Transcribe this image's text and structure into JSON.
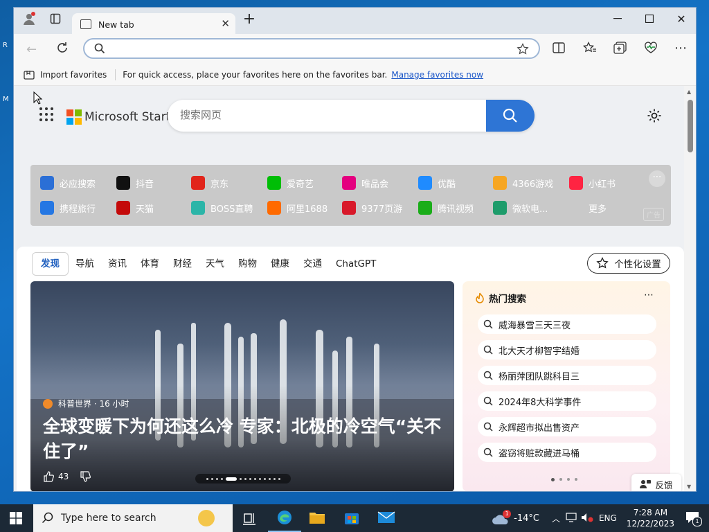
{
  "browser": {
    "tab_title": "New tab",
    "address_value": "",
    "favbar": {
      "import_label": "Import favorites",
      "message": "For quick access, place your favorites here on the favorites bar.",
      "manage_link": "Manage favorites now"
    }
  },
  "start": {
    "brand": "Microsoft Start",
    "search_placeholder": "搜索网页",
    "quick_links": [
      {
        "label": "必应搜索",
        "icon": "bing-search-icon",
        "color": "#2b6fd6"
      },
      {
        "label": "抖音",
        "icon": "douyin-icon",
        "color": "#111111"
      },
      {
        "label": "京东",
        "icon": "jd-icon",
        "color": "#e1251b"
      },
      {
        "label": "爱奇艺",
        "icon": "iqiyi-icon",
        "color": "#00be06"
      },
      {
        "label": "唯品会",
        "icon": "vip-icon",
        "color": "#e4007f"
      },
      {
        "label": "优酷",
        "icon": "youku-icon",
        "color": "#1f8bff"
      },
      {
        "label": "4366游戏",
        "icon": "game-4366-icon",
        "color": "#f6a623"
      },
      {
        "label": "小红书",
        "icon": "xiaohongshu-icon",
        "color": "#ff2442"
      },
      {
        "label": "携程旅行",
        "icon": "ctrip-icon",
        "color": "#2577e3"
      },
      {
        "label": "天猫",
        "icon": "tmall-icon",
        "color": "#c40a0a"
      },
      {
        "label": "BOSS直聘",
        "icon": "boss-icon",
        "color": "#2cb5a8"
      },
      {
        "label": "阿里1688",
        "icon": "ali1688-icon",
        "color": "#ff6a00"
      },
      {
        "label": "9377页游",
        "icon": "game-9377-icon",
        "color": "#d8192a"
      },
      {
        "label": "腾讯视频",
        "icon": "tencent-video-icon",
        "color": "#1aad19"
      },
      {
        "label": "微软电...",
        "icon": "microsoft-store-icon",
        "color": "#1e9c6b"
      },
      {
        "label": "更多",
        "icon": "more-list-icon",
        "color": "#c9c9c9"
      }
    ],
    "ad_label": "广告"
  },
  "feed": {
    "tabs": [
      "发现",
      "导航",
      "资讯",
      "体育",
      "财经",
      "天气",
      "购物",
      "健康",
      "交通",
      "ChatGPT"
    ],
    "personalize_label": "个性化设置",
    "hero": {
      "source": "科普世界 · 16 小时",
      "title": "全球变暖下为何还这么冷 专家：北极的冷空气“关不住了”",
      "likes": "43"
    },
    "hot_search": {
      "title": "热门搜索",
      "items": [
        "威海暴雪三天三夜",
        "北大天才柳智宇结婚",
        "杨丽萍团队跳科目三",
        "2024年8大科学事件",
        "永辉超市拟出售资产",
        "盗窃将赃款藏进马桶"
      ]
    },
    "feedback_label": "反馈"
  },
  "taskbar": {
    "search_placeholder": "Type here to search",
    "weather": "-14°C",
    "weather_badge": "1",
    "lang": "ENG",
    "time": "7:28 AM",
    "date": "12/22/2023",
    "notification_count": "1"
  }
}
